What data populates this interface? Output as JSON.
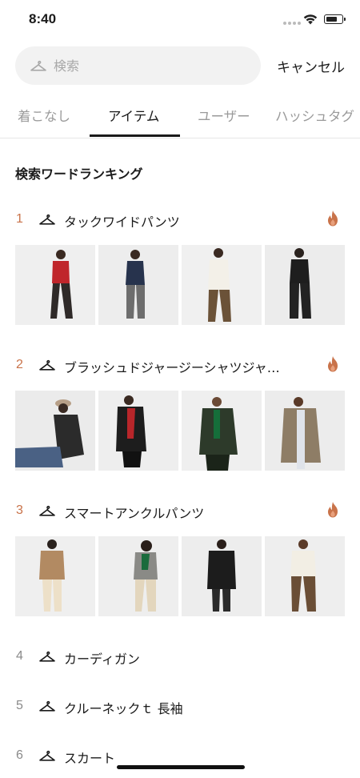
{
  "status_bar": {
    "time": "8:40"
  },
  "search": {
    "placeholder": "検索",
    "cancel_label": "キャンセル"
  },
  "tabs": [
    {
      "label": "着こなし",
      "active": false
    },
    {
      "label": "アイテム",
      "active": true
    },
    {
      "label": "ユーザー",
      "active": false
    },
    {
      "label": "ハッシュタグ",
      "active": false
    }
  ],
  "ranking": {
    "title": "検索ワードランキング",
    "items": [
      {
        "rank": "1",
        "label": "タックワイドパンツ",
        "hot": true
      },
      {
        "rank": "2",
        "label": "ブラッシュドジャージーシャツジャ…",
        "hot": true
      },
      {
        "rank": "3",
        "label": "スマートアンクルパンツ",
        "hot": true
      },
      {
        "rank": "4",
        "label": "カーディガン",
        "hot": false
      },
      {
        "rank": "5",
        "label": "クルーネックｔ 長袖",
        "hot": false
      },
      {
        "rank": "6",
        "label": "スカート",
        "hot": false
      }
    ]
  },
  "colors": {
    "accent": "#c9734a",
    "tab_active": "#1a1a1a",
    "tab_inactive": "#9a9a9a"
  },
  "icons": {
    "hanger": "hanger-icon",
    "flame": "flame-icon"
  }
}
